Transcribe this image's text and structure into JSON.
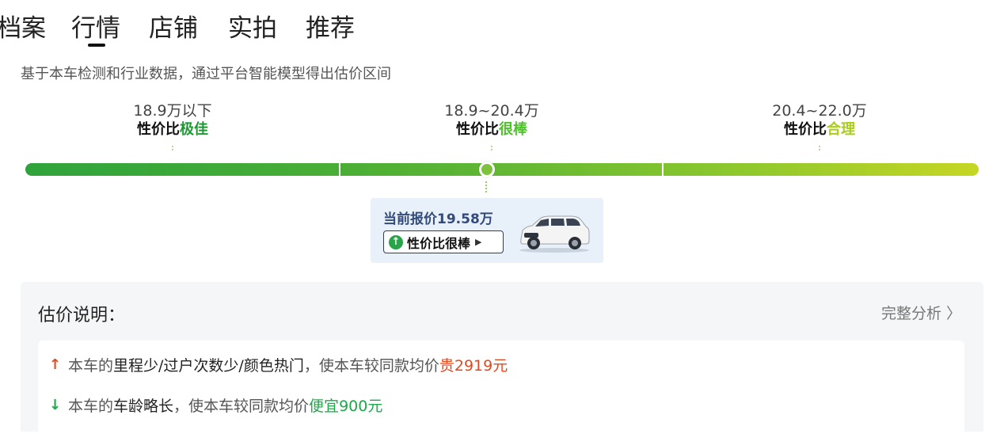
{
  "tabs": [
    {
      "label": "档案"
    },
    {
      "label": "行情",
      "active": true
    },
    {
      "label": "店铺"
    },
    {
      "label": "实拍"
    },
    {
      "label": "推荐"
    }
  ],
  "subtitle": "基于本车检测和行业数据，通过平台智能模型得出估价区间",
  "segments": [
    {
      "range": "18.9万以下",
      "eval_prefix": "性价比",
      "eval_word": "极佳",
      "color": "#1e9a32"
    },
    {
      "range": "18.9~20.4万",
      "eval_prefix": "性价比",
      "eval_word": "很棒",
      "color": "#4cc12a"
    },
    {
      "range": "20.4~22.0万",
      "eval_prefix": "性价比",
      "eval_word": "合理",
      "color": "#a8cd1b"
    }
  ],
  "current": {
    "price_text": "当前报价19.58万",
    "eval_label": "性价比很棒",
    "up_icon": "↑",
    "play_icon": "▶"
  },
  "estimate": {
    "title": "估价说明：",
    "more_label": "完整分析 〉",
    "rows": [
      {
        "arrow": "↑",
        "arrow_color": "#e04a1f",
        "prefix": "本车的",
        "highlight": "里程少/过户次数少/颜色热门",
        "middle": "，使本车较同款均价",
        "direction": "贵",
        "amount": "2919元",
        "color_class": "red"
      },
      {
        "arrow": "↓",
        "arrow_color": "#1fa84a",
        "prefix": "本车的",
        "highlight": "车龄略长",
        "middle": "，使本车较同款均价",
        "direction": "便宜",
        "amount": "900元",
        "color_class": "green"
      }
    ]
  }
}
